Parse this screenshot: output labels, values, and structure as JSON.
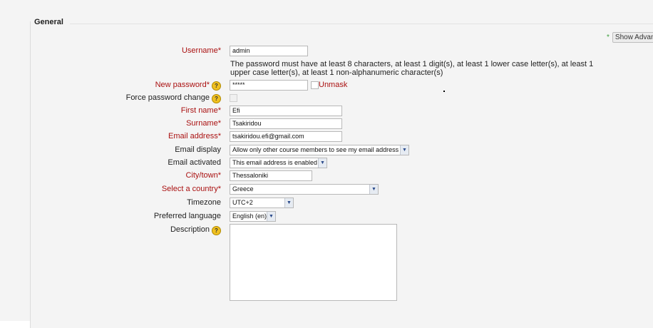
{
  "fieldset": {
    "legend": "General",
    "show_advanced": "Show Advanc"
  },
  "fields": {
    "username": {
      "label": "Username*",
      "value": "admin"
    },
    "password_note": "The password must have at least 8 characters, at least 1 digit(s), at least 1 lower case letter(s), at least 1 upper case letter(s), at least 1 non-alphanumeric character(s)",
    "new_password": {
      "label": "New password*",
      "value": "*****",
      "unmask": "Unmask"
    },
    "force_password_change": {
      "label": "Force password change"
    },
    "first_name": {
      "label": "First name*",
      "value": "Efi"
    },
    "surname": {
      "label": "Surname*",
      "value": "Tsakiridou"
    },
    "email_address": {
      "label": "Email address*",
      "value": "tsakiridou.efi@gmail.com"
    },
    "email_display": {
      "label": "Email display",
      "value": "Allow only other course members to see my email address"
    },
    "email_activated": {
      "label": "Email activated",
      "value": "This email address is enabled"
    },
    "city_town": {
      "label": "City/town*",
      "value": "Thessaloniki"
    },
    "country": {
      "label": "Select a country*",
      "value": "Greece"
    },
    "timezone": {
      "label": "Timezone",
      "value": "UTC+2"
    },
    "preferred_language": {
      "label": "Preferred language",
      "value": "English (en)"
    },
    "description": {
      "label": "Description"
    }
  },
  "icons": {
    "help": "?",
    "dropdown": "▼",
    "required_star": "*"
  }
}
